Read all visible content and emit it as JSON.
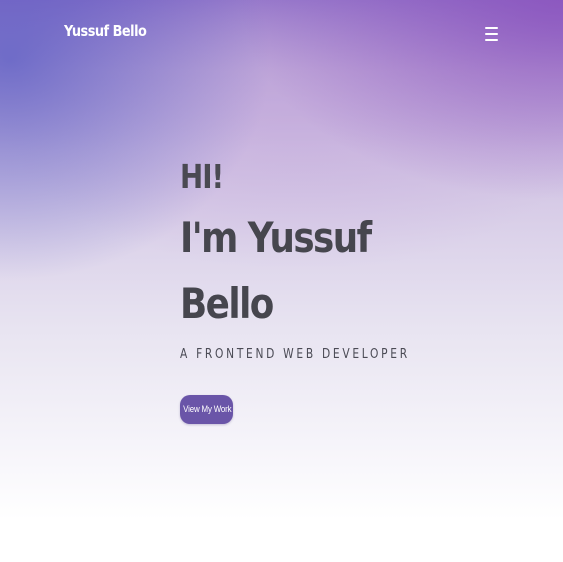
{
  "navbar": {
    "brand": "Yussuf Bello",
    "menu_icon": "hamburger-menu-icon"
  },
  "hero": {
    "greeting": "HI!",
    "name": "I'm Yussuf Bello",
    "tagline": "A FRONTEND WEB DEVELOPER",
    "cta_label": "View My Work"
  },
  "colors": {
    "accent": "#6a55a8",
    "heading_text": "#46464e",
    "gradient_top": "#8f72c8",
    "gradient_bottom": "#ffffff"
  }
}
